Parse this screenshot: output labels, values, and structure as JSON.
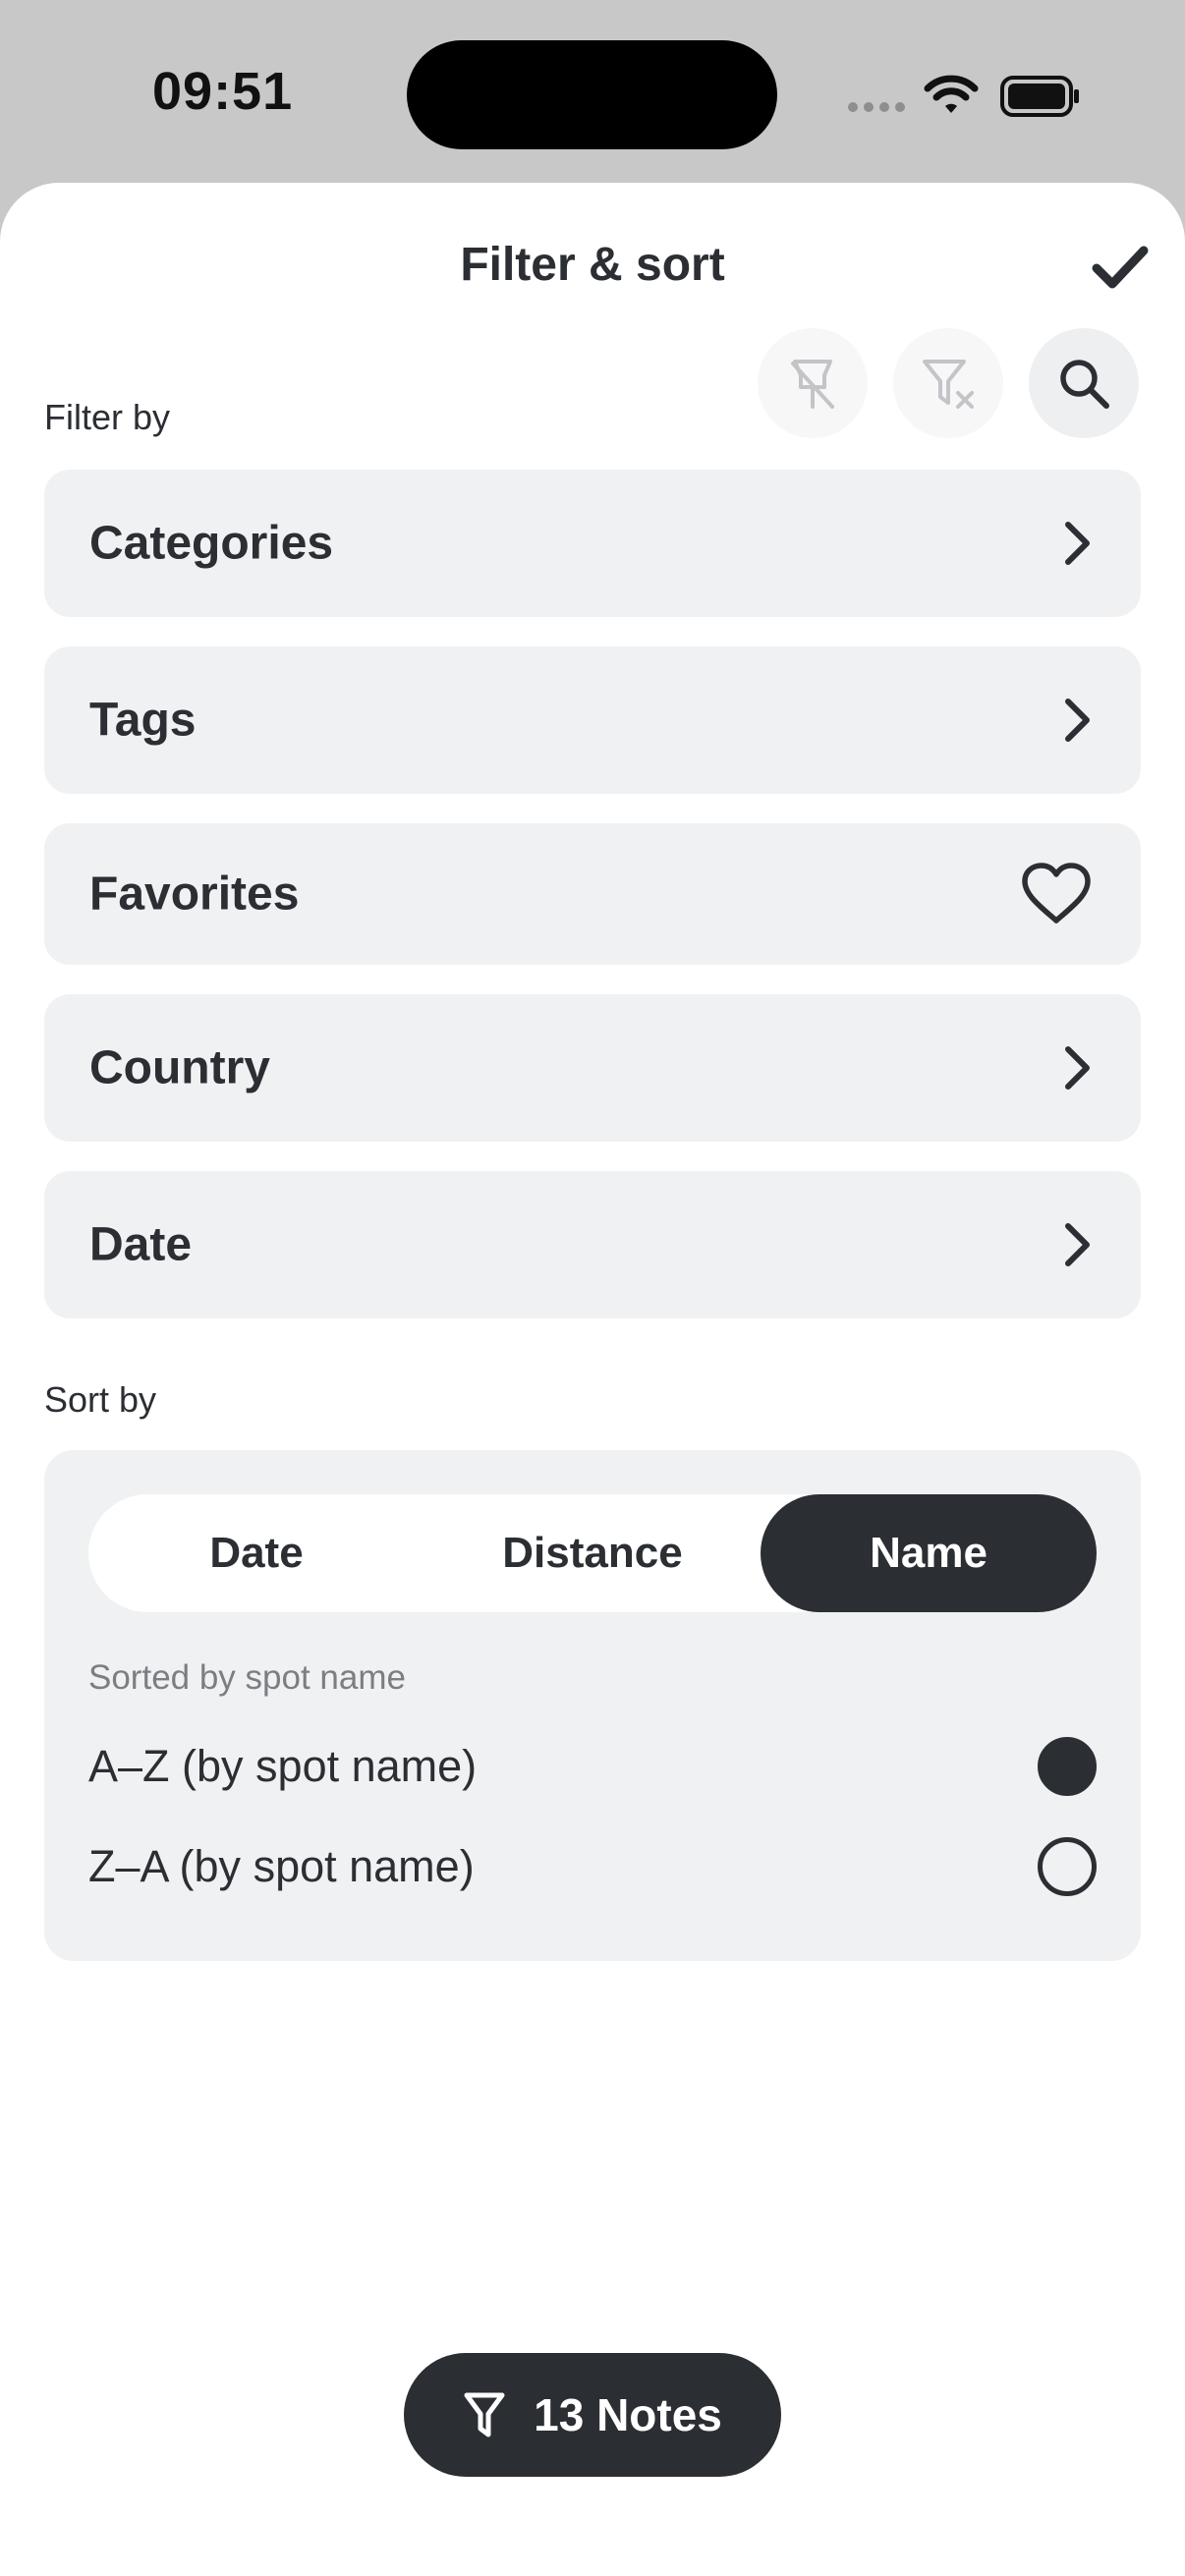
{
  "status_bar": {
    "time": "09:51",
    "icons": [
      "signal-dots-icon",
      "wifi-icon",
      "battery-icon"
    ]
  },
  "sheet": {
    "title": "Filter & sort",
    "done_icon": "checkmark-icon",
    "toolbar_icons": [
      "clear-pin-filter-icon",
      "clear-filter-icon",
      "search-icon"
    ]
  },
  "filter": {
    "section_label": "Filter by",
    "rows": [
      {
        "label": "Categories",
        "icon": "chevron-right-icon"
      },
      {
        "label": "Tags",
        "icon": "chevron-right-icon"
      },
      {
        "label": "Favorites",
        "icon": "heart-icon"
      },
      {
        "label": "Country",
        "icon": "chevron-right-icon"
      },
      {
        "label": "Date",
        "icon": "chevron-right-icon"
      }
    ]
  },
  "sort": {
    "section_label": "Sort by",
    "segments": [
      "Date",
      "Distance",
      "Name"
    ],
    "selected_segment": "Name",
    "caption": "Sorted by spot name",
    "options": [
      {
        "label": "A–Z (by spot name)",
        "checked": true
      },
      {
        "label": "Z–A (by spot name)",
        "checked": false
      }
    ]
  },
  "footer": {
    "notes_label": "13 Notes",
    "icon": "filter-funnel-icon"
  },
  "colors": {
    "dark": "#2b2e33",
    "row_bg": "#f0f1f3",
    "backdrop": "#c8c8c8"
  }
}
